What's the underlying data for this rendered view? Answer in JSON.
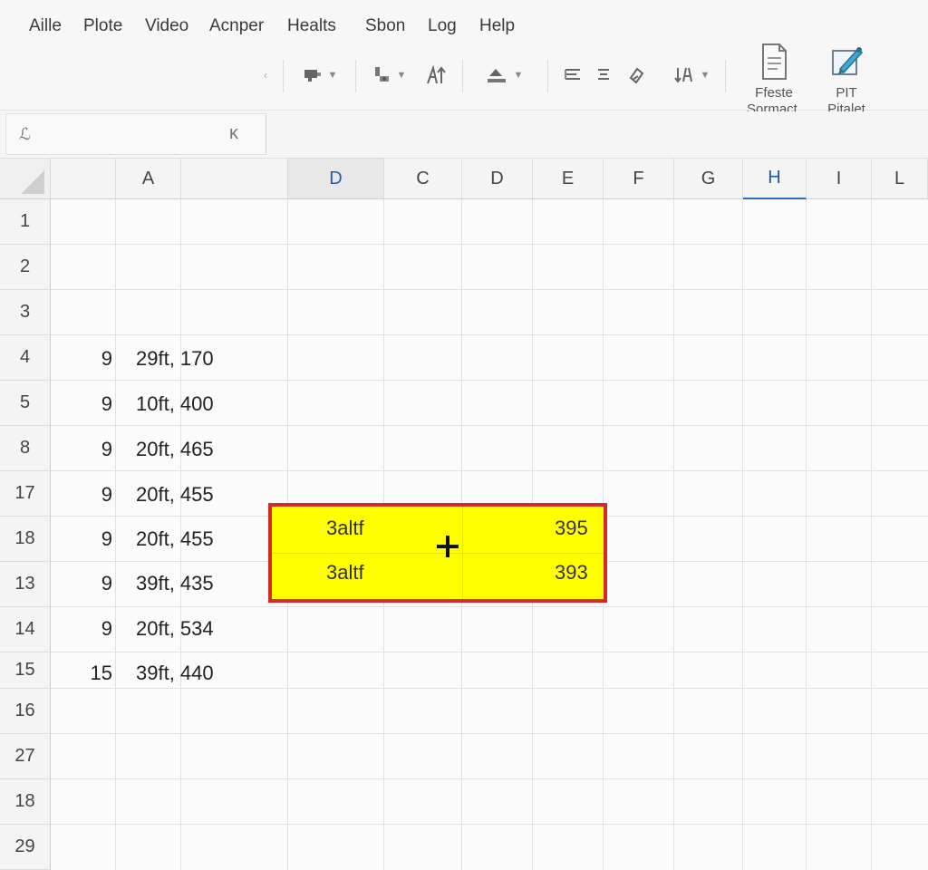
{
  "menu": [
    "Aille",
    "Plote",
    "Video",
    "Acnper",
    "Healts",
    "Sbon",
    "Log",
    "Help"
  ],
  "ribbon": {
    "big_buttons": [
      {
        "icon": "document-format-icon",
        "line1": "Ffeste",
        "line2": "Sormact."
      },
      {
        "icon": "pen-edit-icon",
        "line1": "PIT",
        "line2": "Pitalet"
      }
    ]
  },
  "formula_bar": {
    "left_glyph": "ℒ",
    "right_glyph": "ĸ"
  },
  "columns": [
    "A",
    "D",
    "C",
    "D",
    "E",
    "F",
    "G",
    "H",
    "I",
    "L"
  ],
  "rows": [
    "1",
    "2",
    "3",
    "4",
    "5",
    "8",
    "17",
    "18",
    "13",
    "14",
    "15",
    "16",
    "27",
    "18",
    "29"
  ],
  "cells": [
    {
      "row": "4",
      "num": "9",
      "text": "29ft, 170"
    },
    {
      "row": "5",
      "num": "9",
      "text": "10ft, 400"
    },
    {
      "row": "8",
      "num": "9",
      "text": "20ft, 465"
    },
    {
      "row": "17",
      "num": "9",
      "text": "20ft, 455"
    },
    {
      "row": "18",
      "num": "9",
      "text": "20ft, 455"
    },
    {
      "row": "13",
      "num": "9",
      "text": "39ft, 435"
    },
    {
      "row": "14",
      "num": "9",
      "text": "20ft, 534"
    },
    {
      "row": "15",
      "num": "15",
      "text": "39ft, 440"
    }
  ],
  "selection": {
    "fill_color": "#ffff00",
    "border_color": "#d42a2a",
    "rows": [
      {
        "label": "3altf",
        "value": "395"
      },
      {
        "label": "3altf",
        "value": "393"
      }
    ]
  }
}
